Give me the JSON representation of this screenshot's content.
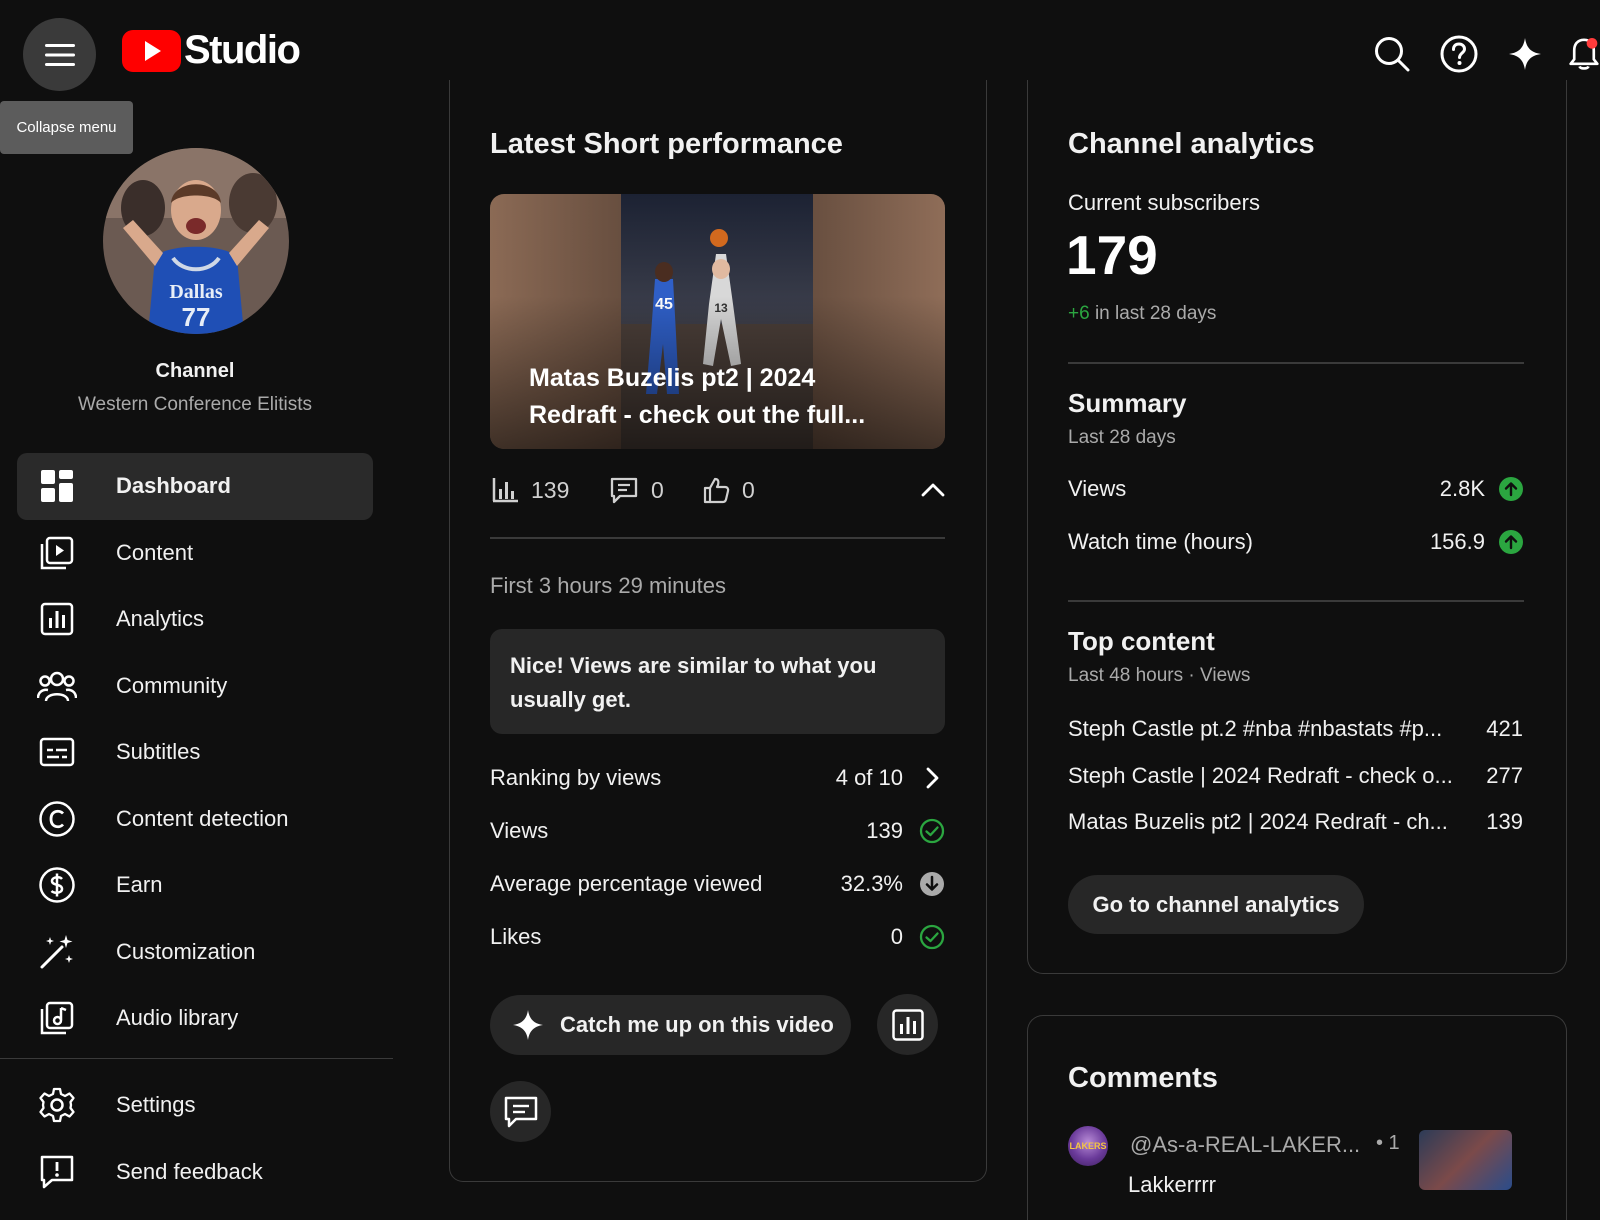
{
  "header": {
    "tooltip": "Collapse menu",
    "logo_text": "Studio"
  },
  "sidebar": {
    "channel_label": "Channel",
    "channel_name": "Western Conference Elitists",
    "items": [
      {
        "label": "Dashboard",
        "icon": "dashboard-icon",
        "active": true
      },
      {
        "label": "Content",
        "icon": "content-icon"
      },
      {
        "label": "Analytics",
        "icon": "analytics-icon"
      },
      {
        "label": "Community",
        "icon": "community-icon"
      },
      {
        "label": "Subtitles",
        "icon": "subtitles-icon"
      },
      {
        "label": "Content detection",
        "icon": "copyright-icon"
      },
      {
        "label": "Earn",
        "icon": "dollar-icon"
      },
      {
        "label": "Customization",
        "icon": "magic-wand-icon"
      },
      {
        "label": "Audio library",
        "icon": "audio-library-icon"
      }
    ],
    "bottom_items": [
      {
        "label": "Settings",
        "icon": "gear-icon"
      },
      {
        "label": "Send feedback",
        "icon": "feedback-icon"
      }
    ]
  },
  "latest_short": {
    "title": "Latest Short performance",
    "video_title": "Matas Buzelis pt2 | 2024 Redraft - check out the full...",
    "views": "139",
    "comments": "0",
    "likes": "0",
    "period": "First 3 hours 29 minutes",
    "message": "Nice! Views are similar to what you usually get.",
    "metrics": [
      {
        "label": "Ranking by views",
        "value": "4 of 10",
        "icon": "chevron-right-icon"
      },
      {
        "label": "Views",
        "value": "139",
        "icon": "check-circle-icon"
      },
      {
        "label": "Average percentage viewed",
        "value": "32.3%",
        "icon": "arrow-down-circle-icon"
      },
      {
        "label": "Likes",
        "value": "0",
        "icon": "check-circle-icon"
      }
    ],
    "catch_up_label": "Catch me up on this video"
  },
  "channel_analytics": {
    "title": "Channel analytics",
    "subscribers_label": "Current subscribers",
    "subscribers": "179",
    "subscribers_delta": "+6",
    "subscribers_delta_suffix": " in last 28 days",
    "summary_title": "Summary",
    "summary_period": "Last 28 days",
    "summary": [
      {
        "label": "Views",
        "value": "2.8K"
      },
      {
        "label": "Watch time (hours)",
        "value": "156.9"
      }
    ],
    "top_content_title": "Top content",
    "top_content_period": "Last 48 hours · Views",
    "top_content": [
      {
        "title": "Steph Castle pt.2 #nba #nbastats #p...",
        "views": "421"
      },
      {
        "title": "Steph Castle | 2024 Redraft - check o...",
        "views": "277"
      },
      {
        "title": "Matas Buzelis pt2 | 2024 Redraft - ch...",
        "views": "139"
      }
    ],
    "button_label": "Go to channel analytics"
  },
  "comments": {
    "title": "Comments",
    "user": "@As-a-REAL-LAKER...",
    "meta": "• 1",
    "text": "Lakkerrrr",
    "avatar_text": "LAKERS"
  },
  "colors": {
    "background": "#0f0f0f",
    "surface": "#272727",
    "positive": "#2ba640",
    "brand_red": "#ff0000"
  }
}
